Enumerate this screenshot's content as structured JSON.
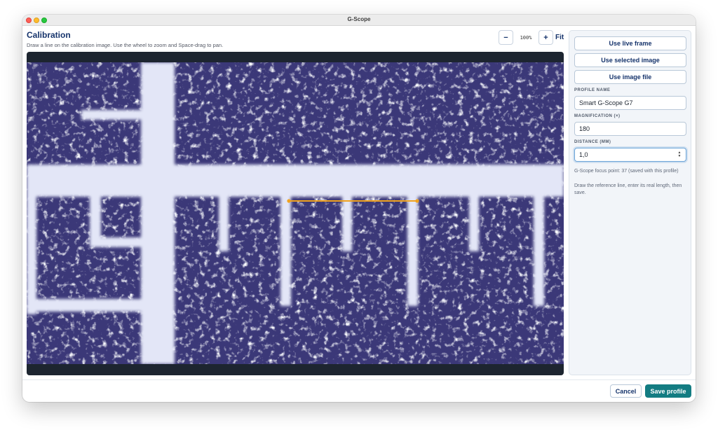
{
  "window": {
    "title": "G-Scope"
  },
  "header": {
    "title": "Calibration",
    "subtitle": "Draw a line on the calibration image. Use the wheel to zoom and Space-drag to pan."
  },
  "zoom": {
    "minus_label": "−",
    "level": "100%",
    "plus_label": "+",
    "fit_label": "Fit"
  },
  "source_buttons": {
    "live_frame": "Use live frame",
    "selected_image": "Use selected image",
    "image_file": "Use image file"
  },
  "form": {
    "profile_name": {
      "label": "PROFILE NAME",
      "value": "Smart G-Scope G7"
    },
    "magnification": {
      "label": "MAGNIFICATION (×)",
      "value": "180"
    },
    "distance": {
      "label": "DISTANCE (MM)",
      "value": "1,0"
    }
  },
  "info": {
    "focus_point": "G-Scope focus point: 37 (saved with this profile)",
    "instructions": "Draw the reference line, enter its real length, then save."
  },
  "footer": {
    "cancel_label": "Cancel",
    "save_label": "Save profile"
  },
  "colors": {
    "accent": "#137c82",
    "primary_text": "#15336b",
    "reference_line": "#f0a21e",
    "micro_dark": "#3b3878",
    "micro_light": "#e3e6f7"
  },
  "icons": {
    "stepper": "chevron-up-down-icon"
  }
}
